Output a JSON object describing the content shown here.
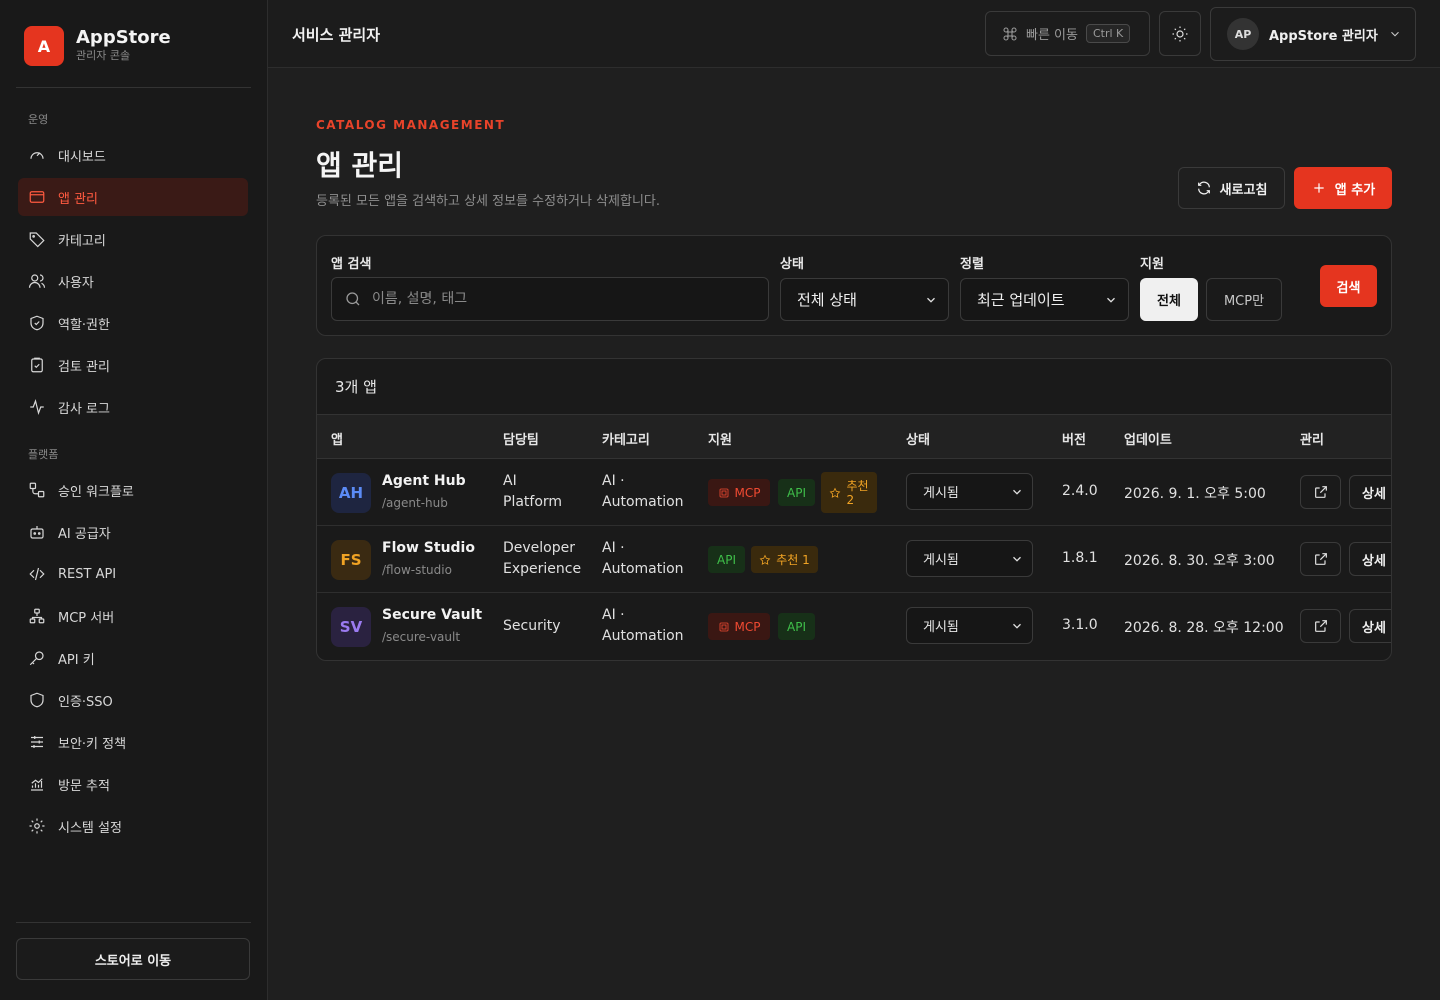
{
  "brand": {
    "logo_letter": "A",
    "name": "AppStore",
    "subtitle": "관리자 콘솔"
  },
  "sidebar": {
    "section_ops": "운영",
    "section_platform": "플랫폼",
    "items": [
      {
        "label": "대시보드",
        "icon": "gauge-icon"
      },
      {
        "label": "앱 관리",
        "icon": "app-window-icon",
        "active": true
      },
      {
        "label": "카테고리",
        "icon": "tag-icon"
      },
      {
        "label": "사용자",
        "icon": "users-icon"
      },
      {
        "label": "역할·권한",
        "icon": "shield-check-icon"
      },
      {
        "label": "검토 관리",
        "icon": "clipboard-check-icon"
      },
      {
        "label": "감사 로그",
        "icon": "activity-icon"
      },
      {
        "label": "승인 워크플로",
        "icon": "workflow-icon"
      },
      {
        "label": "AI 공급자",
        "icon": "bot-icon"
      },
      {
        "label": "REST API",
        "icon": "code-icon"
      },
      {
        "label": "MCP 서버",
        "icon": "network-icon"
      },
      {
        "label": "API 키",
        "icon": "key-icon"
      },
      {
        "label": "인증·SSO",
        "icon": "shield-icon"
      },
      {
        "label": "보안·키 정책",
        "icon": "sliders-icon"
      },
      {
        "label": "방문 추적",
        "icon": "chart-icon"
      },
      {
        "label": "시스템 설정",
        "icon": "gear-icon"
      }
    ],
    "store_button": "스토어로 이동"
  },
  "topbar": {
    "title": "서비스 관리자",
    "quick_nav": "빠른 이동",
    "quick_shortcut": "Ctrl K",
    "user_initials": "AP",
    "user_name": "AppStore 관리자"
  },
  "header": {
    "eyebrow": "CATALOG MANAGEMENT",
    "title": "앱 관리",
    "description": "등록된 모든 앱을 검색하고 상세 정보를 수정하거나 삭제합니다.",
    "refresh_label": "새로고침",
    "add_label": "앱 추가"
  },
  "filters": {
    "search_label": "앱 검색",
    "search_placeholder": "이름, 설명, 태그",
    "status_label": "상태",
    "status_value": "전체 상태",
    "sort_label": "정렬",
    "sort_value": "최근 업데이트",
    "support_label": "지원",
    "support_all": "전체",
    "support_mcp": "MCP만",
    "search_button": "검색"
  },
  "table": {
    "count_label": "3개 앱",
    "columns": [
      "앱",
      "담당팀",
      "카테고리",
      "지원",
      "상태",
      "버전",
      "업데이트",
      "관리"
    ],
    "detail_label": "상세 ·",
    "rows": [
      {
        "initials": "AH",
        "icon_bg": "#1e2540",
        "icon_fg": "#5b8bf5",
        "name": "Agent Hub",
        "slug": "/agent-hub",
        "team_line1": "AI",
        "team_line2": "Platform",
        "cat_line1": "AI ·",
        "cat_line2": "Automation",
        "mcp": "MCP",
        "api": "API",
        "rec_line1": "추천",
        "rec_line2": "2",
        "status": "게시됨",
        "version": "2.4.0",
        "updated": "2026. 9. 1. 오후 5:00"
      },
      {
        "initials": "FS",
        "icon_bg": "#3a2a12",
        "icon_fg": "#f0a324",
        "name": "Flow Studio",
        "slug": "/flow-studio",
        "team_line1": "Developer",
        "team_line2": "Experience",
        "cat_line1": "AI ·",
        "cat_line2": "Automation",
        "api": "API",
        "rec": "추천 1",
        "status": "게시됨",
        "version": "1.8.1",
        "updated": "2026. 8. 30. 오후 3:00"
      },
      {
        "initials": "SV",
        "icon_bg": "#2a2240",
        "icon_fg": "#9b7bf0",
        "name": "Secure Vault",
        "slug": "/secure-vault",
        "team_line1": "Security",
        "cat_line1": "AI ·",
        "cat_line2": "Automation",
        "mcp": "MCP",
        "api": "API",
        "status": "게시됨",
        "version": "3.1.0",
        "updated": "2026. 8. 28. 오후 12:00"
      }
    ]
  }
}
